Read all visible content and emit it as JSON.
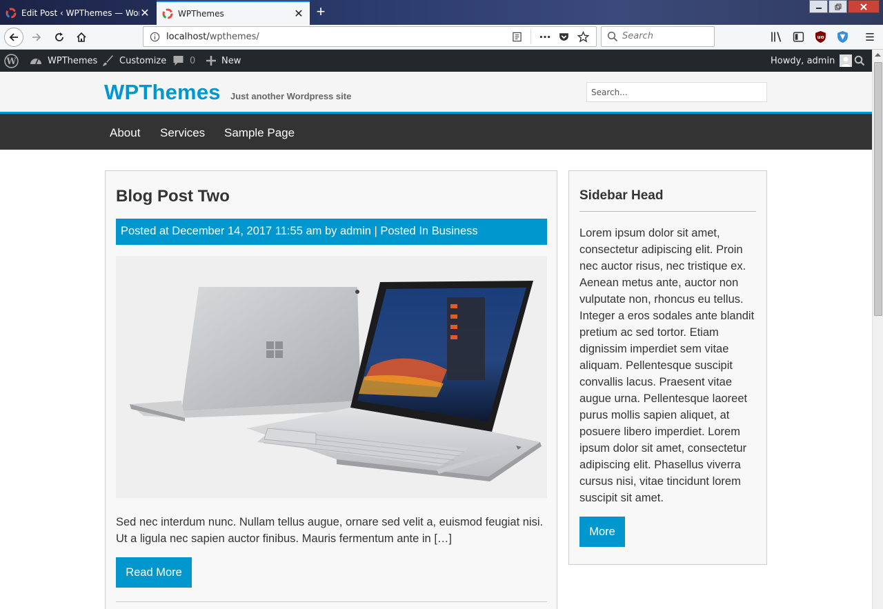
{
  "browser": {
    "tabs": [
      {
        "title": "Edit Post ‹ WPThemes — WordPress",
        "active": false
      },
      {
        "title": "WPThemes",
        "active": true
      }
    ],
    "url_prefix": "localhost/",
    "url_path": "wpthemes/",
    "search_placeholder": "Search"
  },
  "admin_bar": {
    "site_name": "WPThemes",
    "customize": "Customize",
    "comments_count": "0",
    "new_label": "New",
    "howdy": "Howdy, admin"
  },
  "site": {
    "title": "WPThemes",
    "tagline": "Just another Wordpress site",
    "search_placeholder": "Search...",
    "nav": [
      "About",
      "Services",
      "Sample Page"
    ]
  },
  "post": {
    "title": "Blog Post Two",
    "meta": "Posted at December 14, 2017 11:55 am by admin | Posted In Business",
    "excerpt": "Sed nec interdum nunc. Nullam tellus augue, ornare sed velit a, euismod feugiat nisi. Ut a ligula nec sapien auctor finibus. Mauris fermentum ante in […]",
    "read_more": "Read More"
  },
  "sidebar": {
    "heading": "Sidebar Head",
    "text": "Lorem ipsum dolor sit amet, consectetur adipiscing elit. Proin nec auctor risus, nec tristique ex. Aenean metus ante, auctor non vulputate non, rhoncus eu tellus. Integer a eros sodales ante blandit pretium ac sed tortor. Etiam dignissim imperdiet sem vitae aliquam. Pellentesque suscipit convallis lacus. Praesent vitae augue urna. Pellentesque laoreet purus mollis sapien aliquet, at posuere libero imperdiet. Lorem ipsum dolor sit amet, consectetur adipiscing elit. Phasellus viverra cursus nisi, vitae tincidunt lorem suscipit sit amet.",
    "more_button": "More"
  },
  "colors": {
    "accent": "#0097cf",
    "nav_bg": "#333333",
    "admin_bar_bg": "#23282d"
  }
}
